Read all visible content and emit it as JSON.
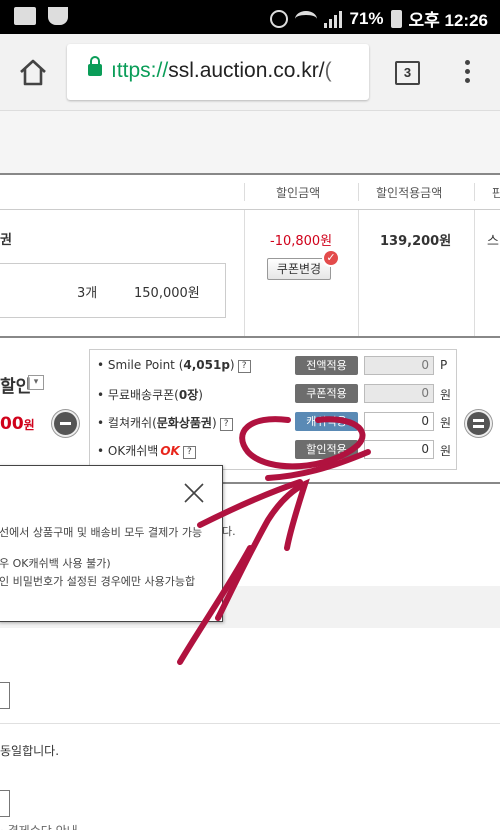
{
  "status_bar": {
    "battery": "71%",
    "time_label": "오후 12:26"
  },
  "browser": {
    "url_scheme_fragment": "ıttps://",
    "url_host": "ssl.auction.co.kr/",
    "url_tail": "(",
    "tab_count": "3"
  },
  "table": {
    "headers": [
      "할인금액",
      "할인적용금액",
      "판"
    ],
    "product_title": "권",
    "quantity": "3개",
    "amount": "150,000원",
    "discount": "-10,800원",
    "coupon_change_label": "쿠폰변경",
    "applied_amount": "139,200원",
    "cut_text": "스"
  },
  "discount_section": {
    "title": "할인",
    "amount": "00",
    "amount_unit": "원",
    "options": [
      {
        "label_pre": "Smile Point (",
        "label_bold": "4,051p",
        "label_post": ")",
        "button": "전액적용",
        "value": "0",
        "unit": "P"
      },
      {
        "label_pre": "무료배송쿠폰(",
        "label_bold": "0장",
        "label_post": ")",
        "button": "쿠폰적용",
        "value": "0",
        "unit": "원"
      },
      {
        "label_pre": "컬쳐캐쉬(",
        "label_bold": "문화상품권",
        "label_post": ")",
        "button": "캐쉬적용",
        "value": "0",
        "unit": "원"
      },
      {
        "label_pre": "OK캐쉬백",
        "label_bold": "",
        "label_post": "",
        "button": "할인적용",
        "value": "0",
        "unit": "원"
      }
    ],
    "ok_logo": "OK"
  },
  "tooltip": {
    "line1": "선에서 상품구매 및 배송비 모두 결제가 가능",
    "line1_overflow": "다.",
    "line2": "우 OK캐쉬백 사용 불가)",
    "line3": "인 비밀번호가 설정된 경우에만 사용가능합"
  },
  "agreement": {
    "text": "동일합니다."
  },
  "bottom_cut": "· 결제수단 안내"
}
